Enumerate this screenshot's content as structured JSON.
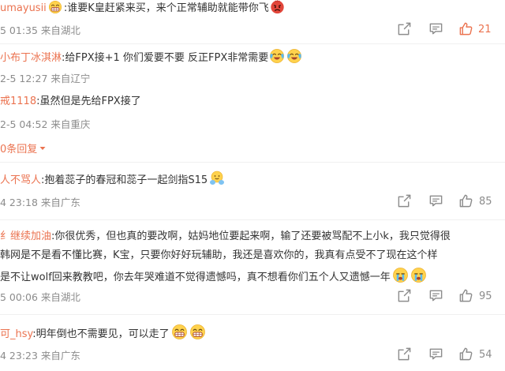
{
  "comments": [
    {
      "user": "umayusii",
      "text": ":谁要K皇赶紧来买，来个正常辅助就能带你飞",
      "meta": "5 01:35 来自湖北",
      "likes": "21",
      "liked": true
    },
    {
      "user": "小布丁冰淇淋",
      "text": ":给FPX接+1 你们爱要不要 反正FPX非常需要",
      "meta": "2-5 12:27 来自辽宁"
    },
    {
      "user": "戒1118",
      "text": ":虽然但是先给FPX接了",
      "meta": "2-5 04:52 来自重庆"
    },
    {
      "more_replies": "0条回复"
    },
    {
      "user": "人不骂人",
      "text": ":抱着蕊子的春冠和蕊子一起剑指S15",
      "meta": "4 23:18 来自广东",
      "likes": "85"
    },
    {
      "user": "纟继续加油",
      "text_lines": [
        ":你很优秀，但也真的要改啊，姑妈地位要起来啊，输了还要被骂配不上小k，我只觉得很",
        "韩网是不是看不懂比赛，K宝，只要你好好玩辅助，我还是喜欢你的，我真有点受不了现在这个样",
        "是不让wolf回来教教吧，你去年哭难道不觉得遗憾吗，真不想看你们五个人又遗憾一年"
      ],
      "meta": "5 00:06 来自湖北",
      "likes": "95"
    },
    {
      "user": "可_hsy",
      "text": ":明年倒也不需要见，可以走了",
      "meta": "4 23:23 来自广东",
      "likes": "54"
    }
  ],
  "icons": [
    "share-icon",
    "comment-icon",
    "thumbs-up-icon",
    "angry-emoji",
    "tears-emoji",
    "cry-emoji",
    "grin-emoji",
    "hug-emoji",
    "chevron-down-icon"
  ],
  "colors": {
    "username": "#eb7350",
    "text": "#333333",
    "meta": "#8c8c8c",
    "liked": "#eb7350"
  }
}
